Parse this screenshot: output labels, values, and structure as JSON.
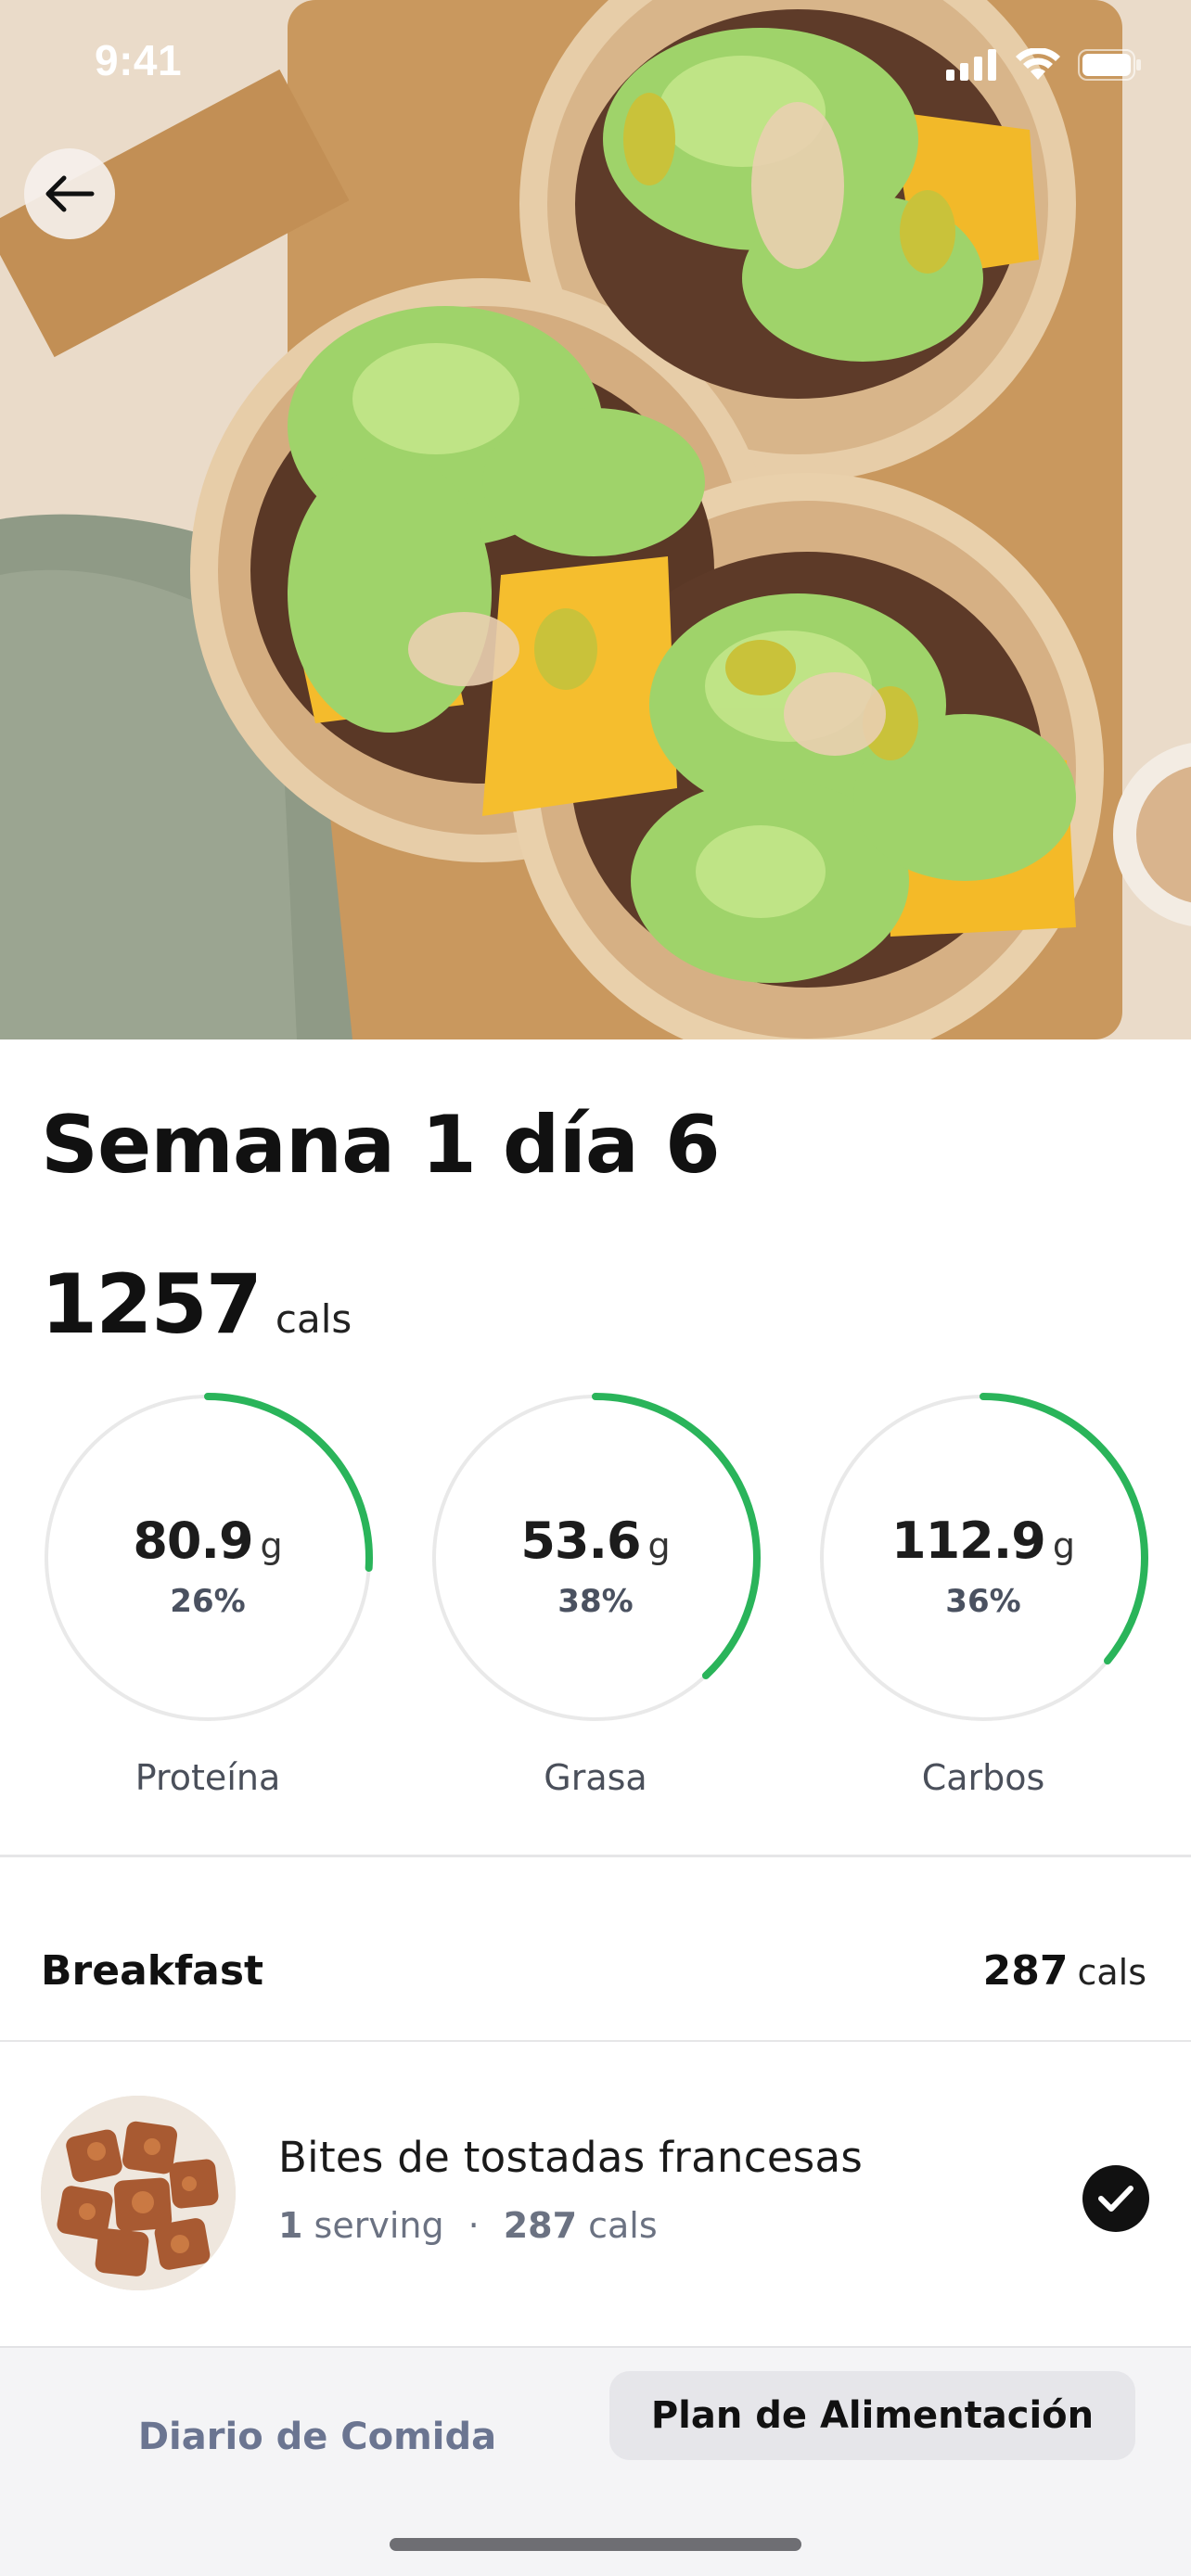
{
  "status": {
    "time": "9:41"
  },
  "header": {
    "back_icon": "arrow-left-icon"
  },
  "plan": {
    "title": "Semana 1 día 6",
    "calories": "1257",
    "calories_unit": "cals"
  },
  "macros": [
    {
      "name": "Proteína",
      "grams": "80.9",
      "unit": "g",
      "percent": "26%",
      "ring_fraction": 0.26,
      "color": "#2ab45a"
    },
    {
      "name": "Grasa",
      "grams": "53.6",
      "unit": "g",
      "percent": "38%",
      "ring_fraction": 0.38,
      "color": "#2ab45a"
    },
    {
      "name": "Carbos",
      "grams": "112.9",
      "unit": "g",
      "percent": "36%",
      "ring_fraction": 0.36,
      "color": "#2ab45a"
    }
  ],
  "meal_section": {
    "title": "Breakfast",
    "calories": "287",
    "calories_unit": "cals",
    "items": [
      {
        "name": "Bites de tostadas francesas",
        "servings": "1",
        "serving_label": "serving",
        "separator": "·",
        "calories": "287",
        "calories_unit": "cals",
        "completed": true
      }
    ]
  },
  "tabs": {
    "food_diary": "Diario de Comida",
    "meal_plan": "Plan de Alimentación",
    "active": "meal_plan"
  },
  "colors": {
    "accent": "#2ab45a",
    "ring_track": "#e9e9e9"
  }
}
